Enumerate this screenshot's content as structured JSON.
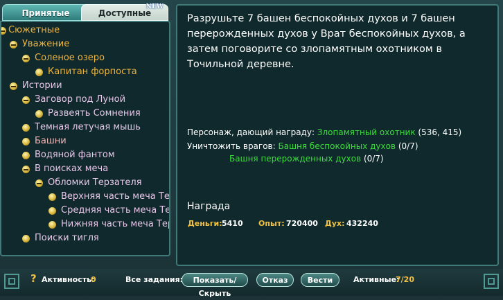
{
  "tabs": {
    "accepted": "Принятые",
    "available": "Доступные",
    "new_badge": "NEW"
  },
  "tree": [
    {
      "label": "Сюжетные",
      "kind": "minus",
      "color": "gold"
    },
    {
      "label": "Уважение",
      "kind": "minus",
      "color": "gold"
    },
    {
      "label": "Соленое озеро",
      "kind": "minus",
      "color": "gold"
    },
    {
      "label": "Капитан форпоста",
      "kind": "dot",
      "color": "gold"
    },
    {
      "label": "Истории",
      "kind": "minus",
      "color": "pink"
    },
    {
      "label": "Заговор под Луной",
      "kind": "minus",
      "color": "pink"
    },
    {
      "label": "Развеять Сомнения",
      "kind": "dot",
      "color": "pink"
    },
    {
      "label": "Темная летучая мышь",
      "kind": "dot",
      "color": "pink"
    },
    {
      "label": "Башни",
      "kind": "dot",
      "color": "sel"
    },
    {
      "label": "Водяной фантом",
      "kind": "dot",
      "color": "pink"
    },
    {
      "label": "В поисках меча",
      "kind": "minus",
      "color": "pink"
    },
    {
      "label": "Обломки Терзателя",
      "kind": "minus",
      "color": "pink"
    },
    {
      "label": "Верхняя часть меча Тер",
      "kind": "dot",
      "color": "pink"
    },
    {
      "label": "Средняя часть меча Тер",
      "kind": "dot",
      "color": "pink"
    },
    {
      "label": "Нижняя часть меча Терз",
      "kind": "dot",
      "color": "pink"
    },
    {
      "label": "Поиски тигля",
      "kind": "dot",
      "color": "pink"
    }
  ],
  "quest": {
    "description": "Разрушьте 7 башен беспокойных духов и 7 башен перерожденных духов у Врат беспокойных духов, а затем  поговорите со злопамятным охотником в Точильной деревне.",
    "giver_label": "Персонаж, дающий награду: ",
    "giver_name": "Злопамятный охотник",
    "giver_coords": " (536, 415)",
    "kill_label": "Уничтожить врагов: ",
    "target1_name": "Башня беспокойных духов",
    "target1_count": " (0/7)",
    "target2_name": "Башня перерожденных духов",
    "target2_count": " (0/7)"
  },
  "reward": {
    "title": "Награда",
    "money_label": "Деньги:",
    "money_value": "5410",
    "exp_label": "Опыт:",
    "exp_value": "720400",
    "spirit_label": "Дух:",
    "spirit_value": "432240"
  },
  "bottom": {
    "activity_label": "Активность:",
    "activity_value": "0",
    "all_tasks_label": "Все задания:",
    "toggle_button": "Показать/Скрыть",
    "refuse_button": "Отказ",
    "lead_button": "Вести",
    "active_label": "Активные:",
    "active_value": "7/20"
  },
  "colors": {
    "gold": "#f0b43a",
    "pink": "#e8c7ea",
    "selected": "#f2b6b6",
    "objective_green": "#3ddc3d"
  }
}
